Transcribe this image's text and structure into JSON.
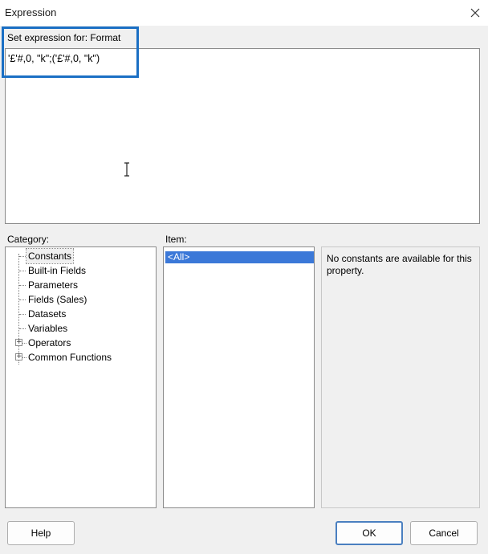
{
  "window": {
    "title": "Expression"
  },
  "editor": {
    "label": "Set expression for: Format",
    "value": "'£'#,0, \"k\";('£'#,0, \"k\")"
  },
  "category": {
    "label": "Category:",
    "items": [
      {
        "label": "Constants",
        "expandable": false,
        "selected": true
      },
      {
        "label": "Built-in Fields",
        "expandable": false
      },
      {
        "label": "Parameters",
        "expandable": false
      },
      {
        "label": "Fields (Sales)",
        "expandable": false
      },
      {
        "label": "Datasets",
        "expandable": false
      },
      {
        "label": "Variables",
        "expandable": false
      },
      {
        "label": "Operators",
        "expandable": true
      },
      {
        "label": "Common Functions",
        "expandable": true
      }
    ]
  },
  "item": {
    "label": "Item:",
    "selected": "<All>"
  },
  "description": "No constants are available for this property.",
  "buttons": {
    "help": "Help",
    "ok": "OK",
    "cancel": "Cancel"
  },
  "colors": {
    "highlight_border": "#1a6fc4",
    "selection": "#3b78d8"
  }
}
